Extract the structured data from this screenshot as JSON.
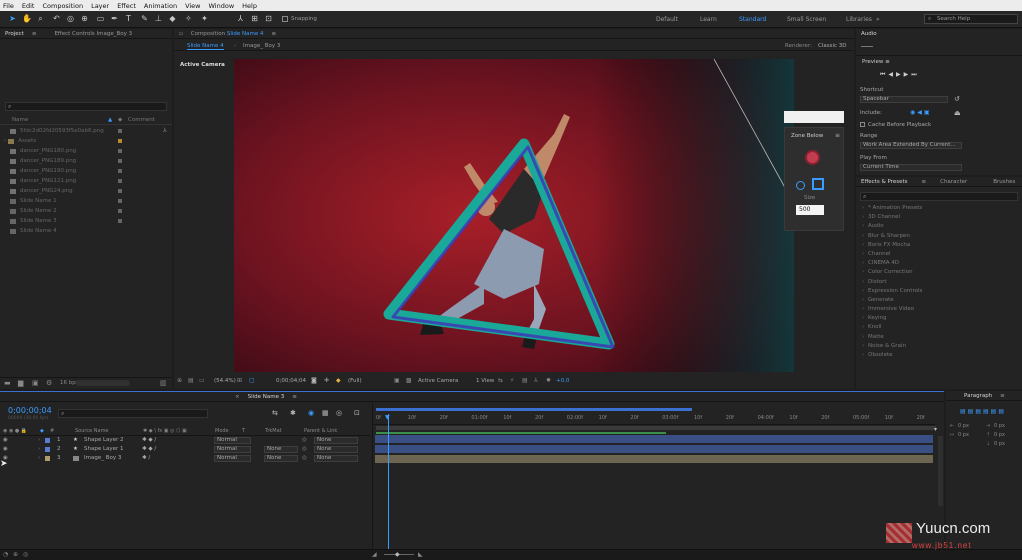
{
  "menu": [
    "File",
    "Edit",
    "Composition",
    "Layer",
    "Effect",
    "Animation",
    "View",
    "Window",
    "Help"
  ],
  "toolbar": {
    "snapping": "Snapping",
    "workspaces": [
      "Default",
      "Learn",
      "Standard",
      "Small Screen",
      "Libraries"
    ],
    "active_workspace": "Standard",
    "search": "Search Help"
  },
  "project": {
    "tab": "Project",
    "tab2": "Effect Controls Image_Boy 3",
    "col_name": "Name",
    "col_comment": "Comment",
    "items": [
      "5fdc2d02fd20593f5e0ab6.png",
      "Assets",
      "dancer_PNG180.png",
      "dancer_PNG189.png",
      "dancer_PNG190.png",
      "dancer_PNG121.png",
      "dancer_PNG24.png",
      "Slide Name 1",
      "Slide Name 2",
      "Slide Name 3",
      "Slide Name 4"
    ],
    "bpc": "16 bpc"
  },
  "comp": {
    "tab": "Composition",
    "comp_name": "Slide Name 4",
    "subtab1": "Slide Name 4",
    "subtab2": "Image_ Boy 3",
    "renderer_label": "Renderer:",
    "renderer": "Classic 3D",
    "view_label": "Active Camera",
    "zoom": "(54.4%)",
    "time": "0;00;04;04",
    "res": "(Full)",
    "camera": "Active Camera",
    "views": "1 View",
    "exposure": "+0.0"
  },
  "zone": {
    "title": "Zone Below",
    "size_label": "Size",
    "size": "500"
  },
  "audio": {
    "tab": "Audio",
    "preview": "Preview",
    "shortcut_label": "Shortcut",
    "shortcut": "Spacebar",
    "include": "Include:",
    "cache": "Cache Before Playback",
    "range_label": "Range",
    "range": "Work Area Extended By Current...",
    "playfrom_label": "Play From",
    "playfrom": "Current Time"
  },
  "effects": {
    "tabs": [
      "Effects & Presets",
      "Character",
      "Brushes"
    ],
    "items": [
      "* Animation Presets",
      "3D Channel",
      "Audio",
      "Blur & Sharpen",
      "Boris FX Mocha",
      "Channel",
      "CINEMA 4D",
      "Color Correction",
      "Distort",
      "Expression Controls",
      "Generate",
      "Immersive Video",
      "Keying",
      "Knoll",
      "Matte",
      "Noise & Grain",
      "Obsolete"
    ]
  },
  "timeline": {
    "tab": "Slide Name 3",
    "timecode": "0;00;00;04",
    "fps": "00004 (30.00 fps)",
    "cols": {
      "source": "Source Name",
      "mode": "Mode",
      "t": "T",
      "trkmat": "TrkMat",
      "parent": "Parent & Link"
    },
    "layers": [
      {
        "num": "1",
        "name": "Shape Layer 2",
        "mode": "Normal",
        "trk": "",
        "parent": "None",
        "color": "#5a7cd0"
      },
      {
        "num": "2",
        "name": "Shape Layer 1",
        "mode": "Normal",
        "trk": "None",
        "parent": "None",
        "color": "#5a7cd0"
      },
      {
        "num": "3",
        "name": "Image_ Boy 3",
        "mode": "Normal",
        "trk": "None",
        "parent": "None",
        "color": "#b39a6a"
      }
    ],
    "ticks": [
      "0f",
      "10f",
      "20f",
      "01:00f",
      "10f",
      "20f",
      "02:00f",
      "10f",
      "20f",
      "03:00f",
      "10f",
      "20f",
      "04:00f",
      "10f",
      "20f",
      "05:00f",
      "10f",
      "20f"
    ]
  },
  "paragraph": {
    "tab": "Paragraph",
    "px": "0 px"
  },
  "watermark": {
    "main": "Yuucn.com",
    "sub": "www.jb51.net"
  }
}
